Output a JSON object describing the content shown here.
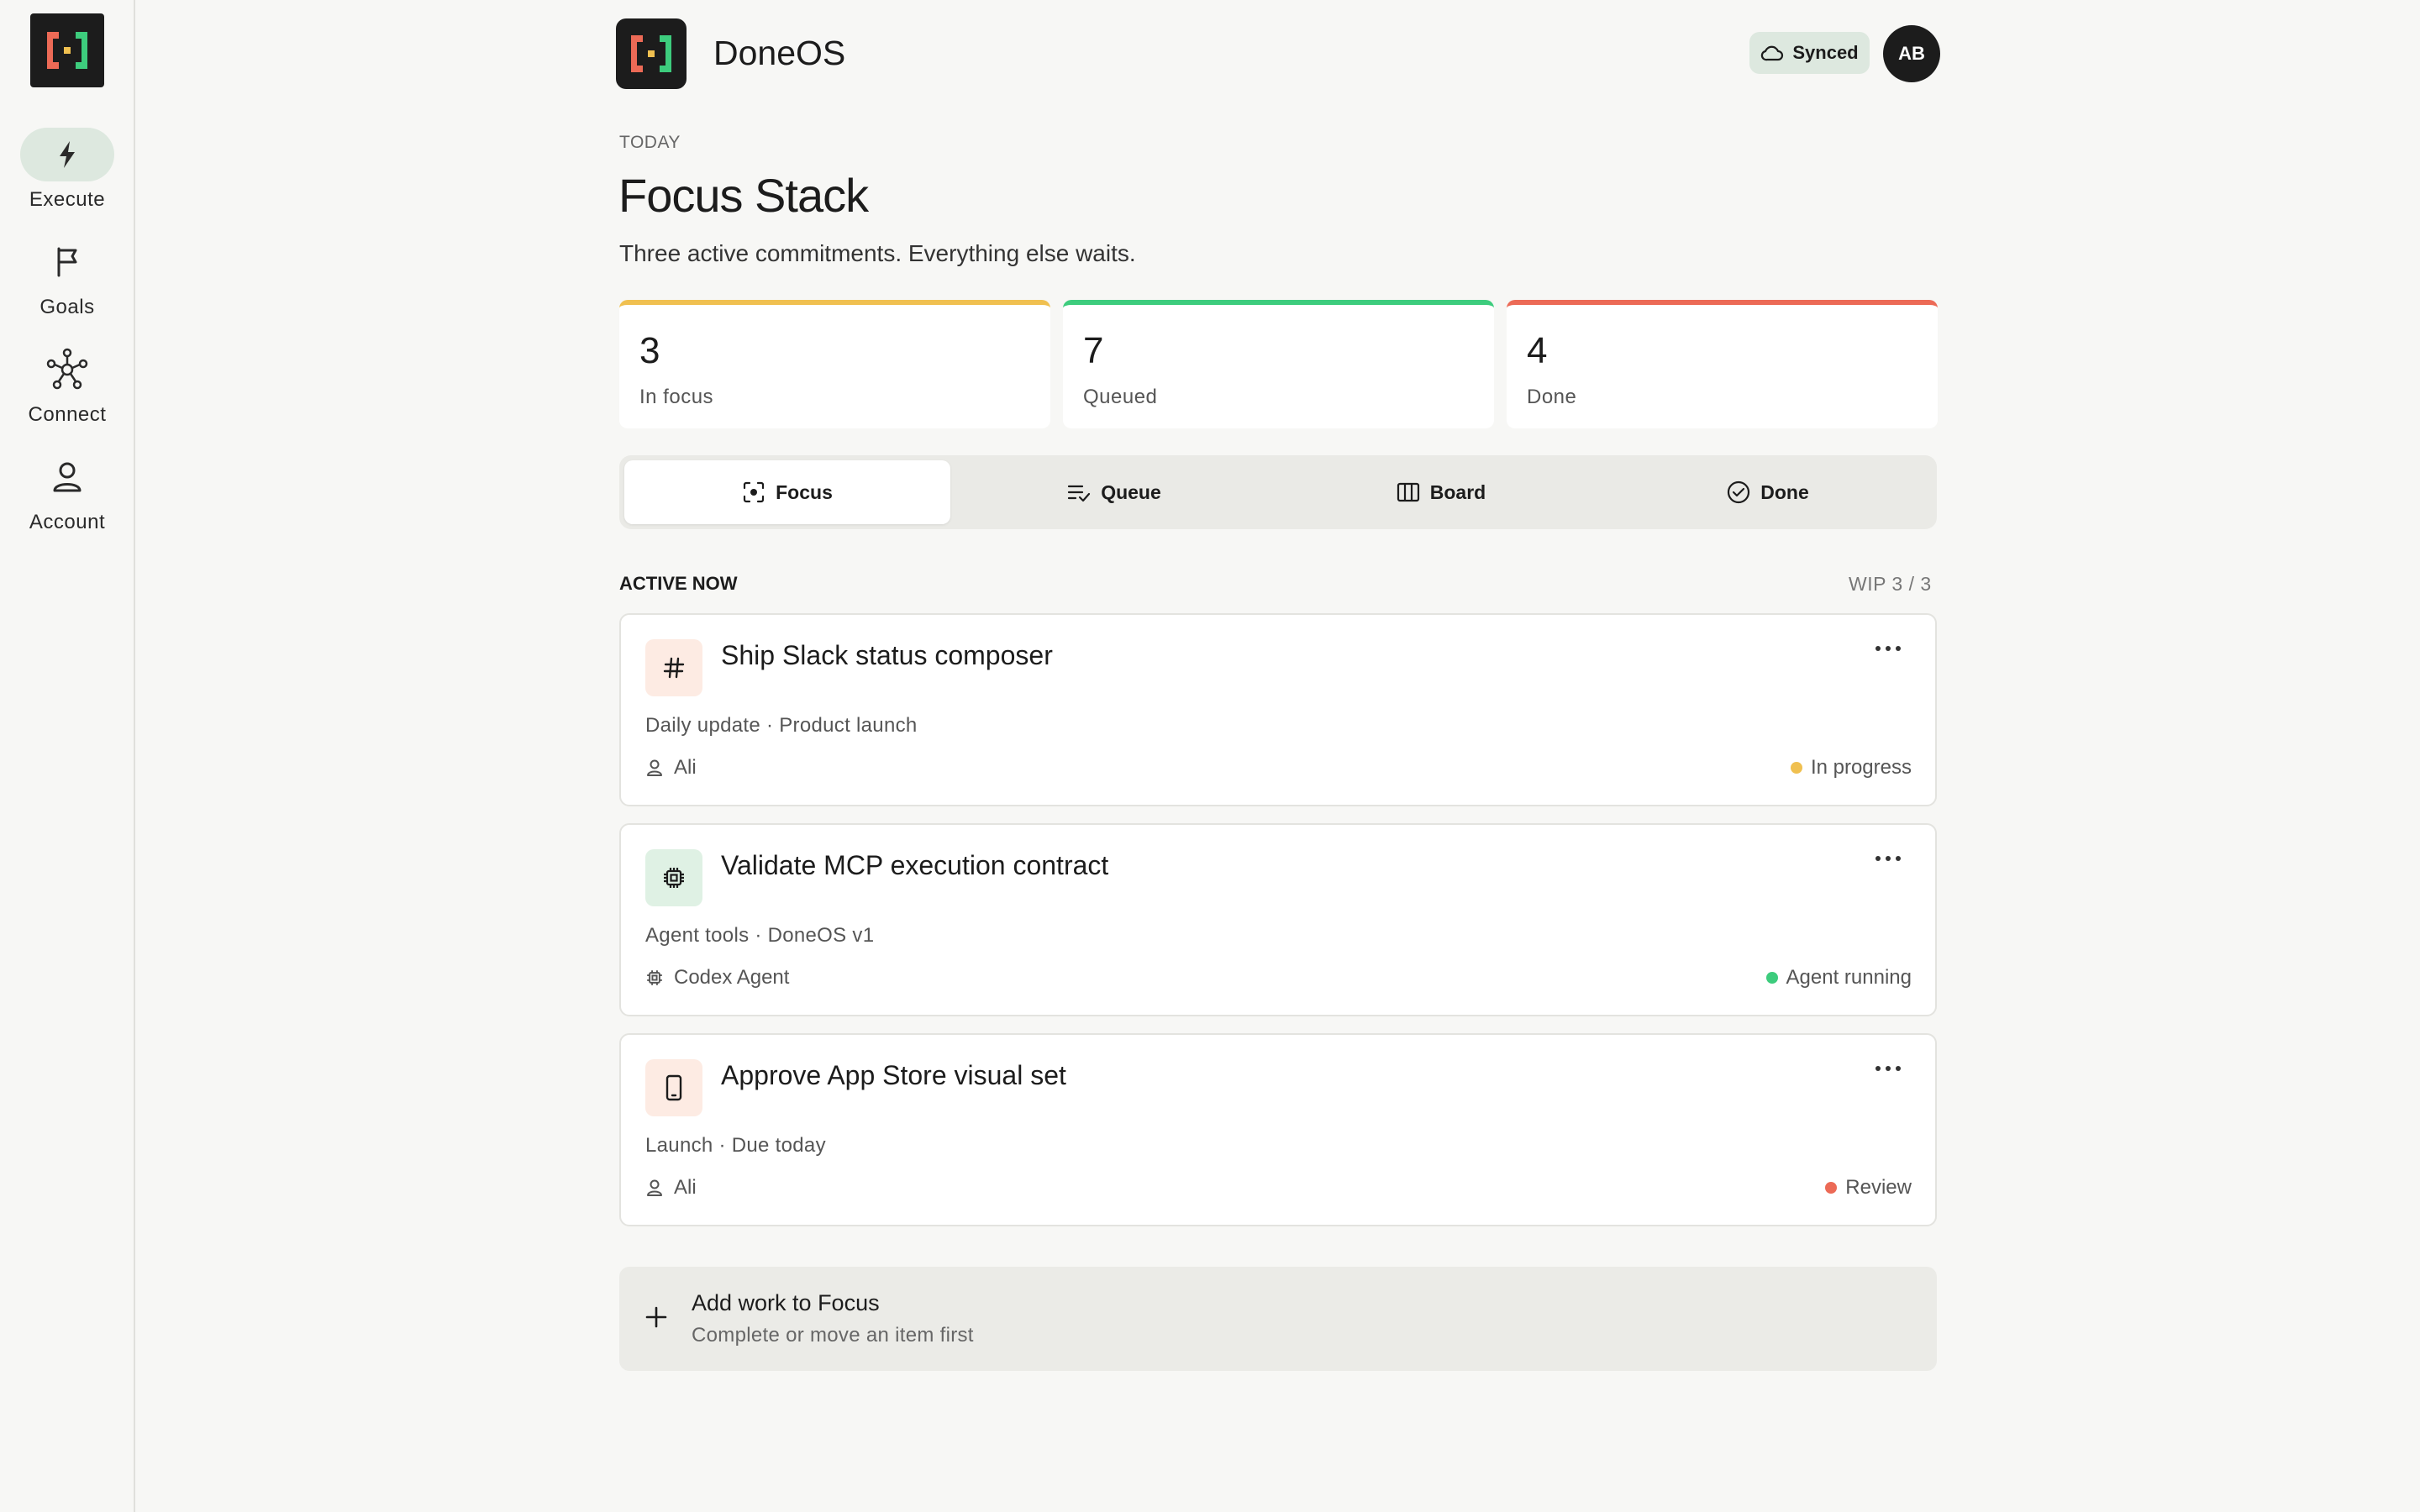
{
  "app": {
    "name": "DoneOS"
  },
  "colors": {
    "accent_yellow": "#f0c050",
    "accent_green": "#3dcc7d",
    "accent_red": "#ec6a56",
    "sidebar_active": "#dde8df"
  },
  "sidebar": {
    "items": [
      {
        "label": "Execute",
        "icon": "bolt-icon",
        "active": true
      },
      {
        "label": "Goals",
        "icon": "flag-icon",
        "active": false
      },
      {
        "label": "Connect",
        "icon": "network-icon",
        "active": false
      },
      {
        "label": "Account",
        "icon": "user-icon",
        "active": false
      }
    ]
  },
  "header": {
    "sync_label": "Synced",
    "avatar_initials": "AB"
  },
  "page": {
    "eyebrow": "TODAY",
    "title": "Focus Stack",
    "subtitle": "Three active commitments. Everything else waits."
  },
  "stats": [
    {
      "value": "3",
      "label": "In focus",
      "color": "#f0c050"
    },
    {
      "value": "7",
      "label": "Queued",
      "color": "#3dcc7d"
    },
    {
      "value": "4",
      "label": "Done",
      "color": "#ec6a56"
    }
  ],
  "tabs": [
    {
      "label": "Focus",
      "icon": "focus-icon",
      "active": true
    },
    {
      "label": "Queue",
      "icon": "queue-icon",
      "active": false
    },
    {
      "label": "Board",
      "icon": "board-icon",
      "active": false
    },
    {
      "label": "Done",
      "icon": "check-circle-icon",
      "active": false
    }
  ],
  "section": {
    "title": "ACTIVE NOW",
    "wip": "WIP 3 / 3"
  },
  "tasks": [
    {
      "title": "Ship Slack status composer",
      "meta": "Daily update · Product launch",
      "owner": "Ali",
      "owner_icon": "user-icon",
      "status": "In progress",
      "status_color": "#f0c050",
      "icon": "hash-icon",
      "icon_bg": "#fdebe3"
    },
    {
      "title": "Validate MCP execution contract",
      "meta": "Agent tools · DoneOS v1",
      "owner": "Codex Agent",
      "owner_icon": "chip-icon",
      "status": "Agent running",
      "status_color": "#3dcc7d",
      "icon": "chip-icon",
      "icon_bg": "#dff1e4"
    },
    {
      "title": "Approve App Store visual set",
      "meta": "Launch · Due today",
      "owner": "Ali",
      "owner_icon": "user-icon",
      "status": "Review",
      "status_color": "#ec6a56",
      "icon": "phone-icon",
      "icon_bg": "#fdebe3"
    }
  ],
  "add_work": {
    "title": "Add work to Focus",
    "subtitle": "Complete or move an item first"
  }
}
